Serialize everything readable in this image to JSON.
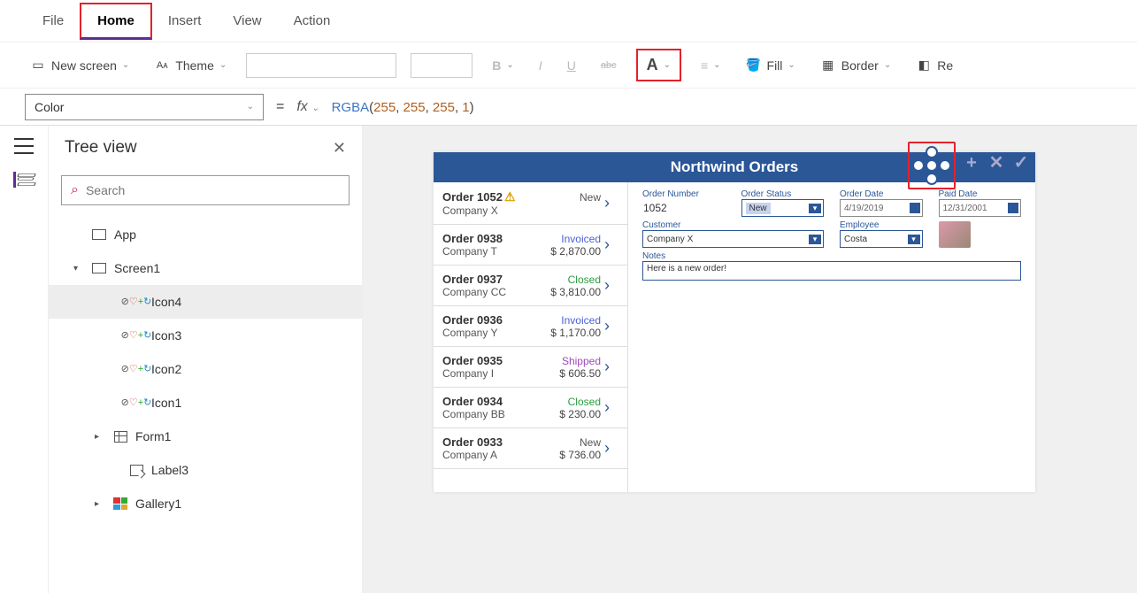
{
  "menu": {
    "file": "File",
    "home": "Home",
    "insert": "Insert",
    "view": "View",
    "action": "Action"
  },
  "ribbon": {
    "new_screen": "New screen",
    "theme": "Theme",
    "fill": "Fill",
    "border": "Border",
    "reorder": "Re"
  },
  "formula": {
    "property": "Color",
    "fx": "fx",
    "func": "RGBA",
    "args": [
      "255",
      "255",
      "255",
      "1"
    ]
  },
  "tree": {
    "title": "Tree view",
    "search_placeholder": "Search",
    "items": [
      {
        "label": "App",
        "icon": "screen",
        "indent": 1
      },
      {
        "label": "Screen1",
        "icon": "screen",
        "indent": 1,
        "caret": "▾"
      },
      {
        "label": "Icon4",
        "icon": "multi",
        "indent": 3,
        "selected": true
      },
      {
        "label": "Icon3",
        "icon": "multi",
        "indent": 3
      },
      {
        "label": "Icon2",
        "icon": "multi",
        "indent": 3
      },
      {
        "label": "Icon1",
        "icon": "multi",
        "indent": 3
      },
      {
        "label": "Form1",
        "icon": "form",
        "indent": 2,
        "caret": "▸"
      },
      {
        "label": "Label3",
        "icon": "label",
        "indent": 3
      },
      {
        "label": "Gallery1",
        "icon": "gallery",
        "indent": 2,
        "caret": "▸"
      }
    ]
  },
  "app": {
    "title": "Northwind Orders",
    "orders": [
      {
        "title": "Order 1052",
        "company": "Company X",
        "status": "New",
        "status_cls": "st-new",
        "amount": "",
        "warn": true
      },
      {
        "title": "Order 0938",
        "company": "Company T",
        "status": "Invoiced",
        "status_cls": "st-invoiced",
        "amount": "$ 2,870.00"
      },
      {
        "title": "Order 0937",
        "company": "Company CC",
        "status": "Closed",
        "status_cls": "st-closed",
        "amount": "$ 3,810.00"
      },
      {
        "title": "Order 0936",
        "company": "Company Y",
        "status": "Invoiced",
        "status_cls": "st-invoiced",
        "amount": "$ 1,170.00"
      },
      {
        "title": "Order 0935",
        "company": "Company I",
        "status": "Shipped",
        "status_cls": "st-shipped",
        "amount": "$ 606.50"
      },
      {
        "title": "Order 0934",
        "company": "Company BB",
        "status": "Closed",
        "status_cls": "st-closed",
        "amount": "$ 230.00"
      },
      {
        "title": "Order 0933",
        "company": "Company A",
        "status": "New",
        "status_cls": "st-new",
        "amount": "$ 736.00"
      }
    ],
    "form": {
      "order_number_label": "Order Number",
      "order_number": "1052",
      "order_status_label": "Order Status",
      "order_status": "New",
      "order_date_label": "Order Date",
      "order_date": "4/19/2019",
      "paid_date_label": "Paid Date",
      "paid_date": "12/31/2001",
      "customer_label": "Customer",
      "customer": "Company X",
      "employee_label": "Employee",
      "employee": "Costa",
      "notes_label": "Notes",
      "notes": "Here is a new order!"
    }
  }
}
